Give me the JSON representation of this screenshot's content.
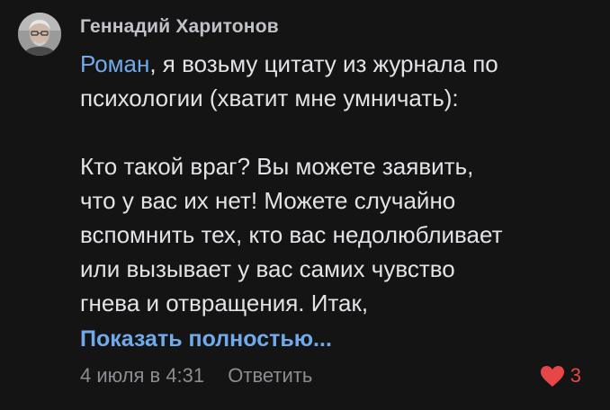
{
  "comment": {
    "author": "Геннадий Харитонов",
    "mention": "Роман",
    "text_after_mention": ", я возьму цитату из журнала по\nпсихологии (хватит мне умничать):\n\nКто такой враг? Вы можете заявить,\nчто у вас их нет! Можете случайно\nвспомнить тех, кто вас недолюбливает\nили вызывает у вас самих чувство\nгнева и отвращения. Итак,",
    "show_more_label": "Показать полностью...",
    "date": "4 июля в 4:31",
    "reply_label": "Ответить",
    "likes_count": "3",
    "liked": true
  },
  "icons": {
    "avatar": "user-avatar-photo",
    "like": "heart-icon"
  },
  "colors": {
    "background": "#141414",
    "text": "#e1e3e6",
    "author": "#bfc2c6",
    "link": "#71aaeb",
    "secondary": "#8a8d91",
    "like": "#e64646"
  }
}
